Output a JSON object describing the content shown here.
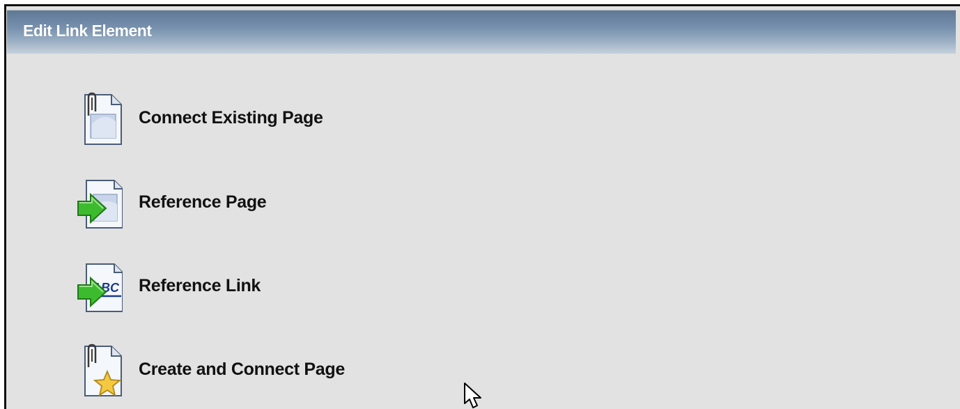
{
  "dialog": {
    "title": "Edit Link Element"
  },
  "options": [
    {
      "label": "Connect Existing Page",
      "icon": "paperclip-page-icon"
    },
    {
      "label": "Reference Page",
      "icon": "page-arrow-icon"
    },
    {
      "label": "Reference Link",
      "icon": "abc-link-arrow-icon"
    },
    {
      "label": "Create and Connect Page",
      "icon": "paperclip-page-star-icon"
    }
  ],
  "colors": {
    "header_gradient_top": "#5e7896",
    "header_gradient_bottom": "#c6d1dc",
    "panel_background": "#e2e2e2",
    "arrow_green": "#3dbb2e",
    "star_yellow": "#f5c842"
  }
}
